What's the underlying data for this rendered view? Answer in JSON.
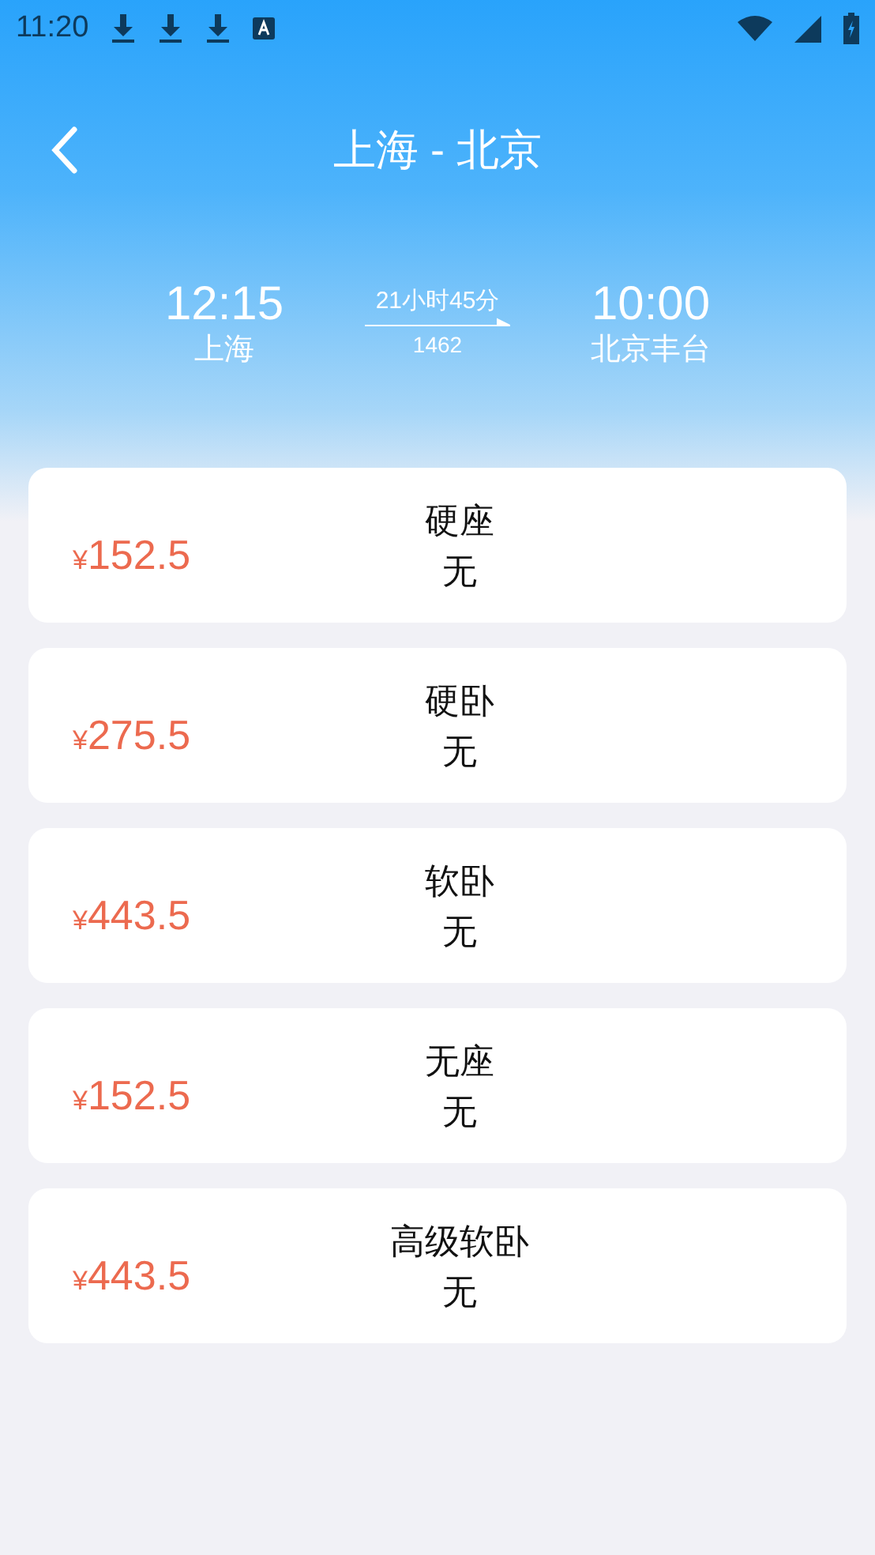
{
  "status_bar": {
    "time": "11:20"
  },
  "header": {
    "title": "上海 - 北京"
  },
  "journey": {
    "depart_time": "12:15",
    "depart_station": "上海",
    "duration": "21小时45分",
    "train_number": "1462",
    "arrive_time": "10:00",
    "arrive_station": "北京丰台"
  },
  "seats": [
    {
      "currency": "¥",
      "price": "152.5",
      "type": "硬座",
      "availability": "无"
    },
    {
      "currency": "¥",
      "price": "275.5",
      "type": "硬卧",
      "availability": "无"
    },
    {
      "currency": "¥",
      "price": "443.5",
      "type": "软卧",
      "availability": "无"
    },
    {
      "currency": "¥",
      "price": "152.5",
      "type": "无座",
      "availability": "无"
    },
    {
      "currency": "¥",
      "price": "443.5",
      "type": "高级软卧",
      "availability": "无"
    }
  ]
}
